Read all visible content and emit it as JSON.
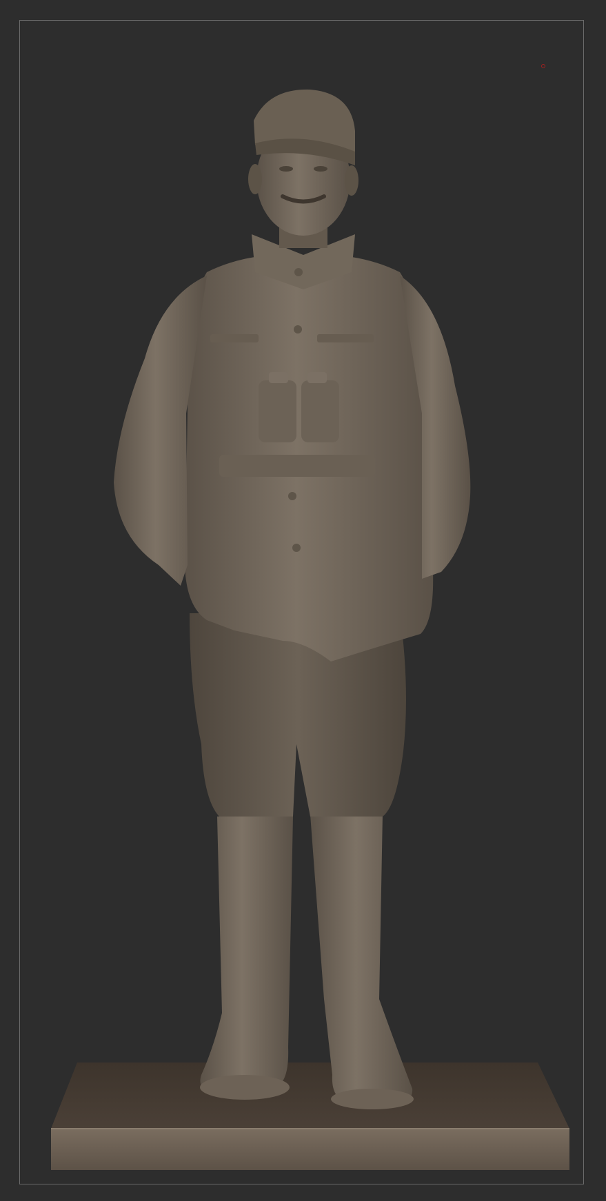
{
  "viewport": {
    "background_color": "#2d2d2d",
    "frame_color": "#6b6b6b",
    "pivot_color": "#a02020"
  },
  "model": {
    "material_color": "#6e6457",
    "base_color": "#4a4037",
    "icon": "sculpt-mesh-icon"
  }
}
